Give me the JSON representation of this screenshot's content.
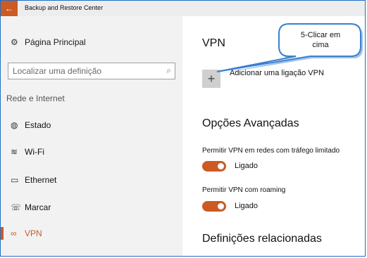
{
  "window": {
    "title": "Backup and Restore Center",
    "back_icon": "←"
  },
  "sidebar": {
    "home": {
      "icon": "⚙",
      "label": "Página Principal"
    },
    "search": {
      "placeholder": "Localizar uma definição",
      "icon": "⌕"
    },
    "section": "Rede e Internet",
    "items": [
      {
        "icon": "◍",
        "label": "Estado"
      },
      {
        "icon": "≋",
        "label": "Wi-Fi"
      },
      {
        "icon": "▭",
        "label": "Ethernet"
      },
      {
        "icon": "☏",
        "label": "Marcar"
      },
      {
        "icon": "∞",
        "label": "VPN"
      }
    ]
  },
  "main": {
    "vpn_heading": "VPN",
    "add_vpn": {
      "icon": "+",
      "label": "Adicionar uma ligação VPN"
    },
    "advanced_heading": "Opções Avançadas",
    "options": [
      {
        "label": "Permitir VPN em redes com tráfego limitado",
        "state": "Ligado"
      },
      {
        "label": "Permitir VPN com roaming",
        "state": "Ligado"
      }
    ],
    "related_heading": "Definições relacionadas"
  },
  "callout": {
    "text_line1": "5-Clicar em",
    "text_line2": "cima"
  },
  "colors": {
    "accent": "#cc5a22",
    "frame": "#1e6fc7"
  }
}
